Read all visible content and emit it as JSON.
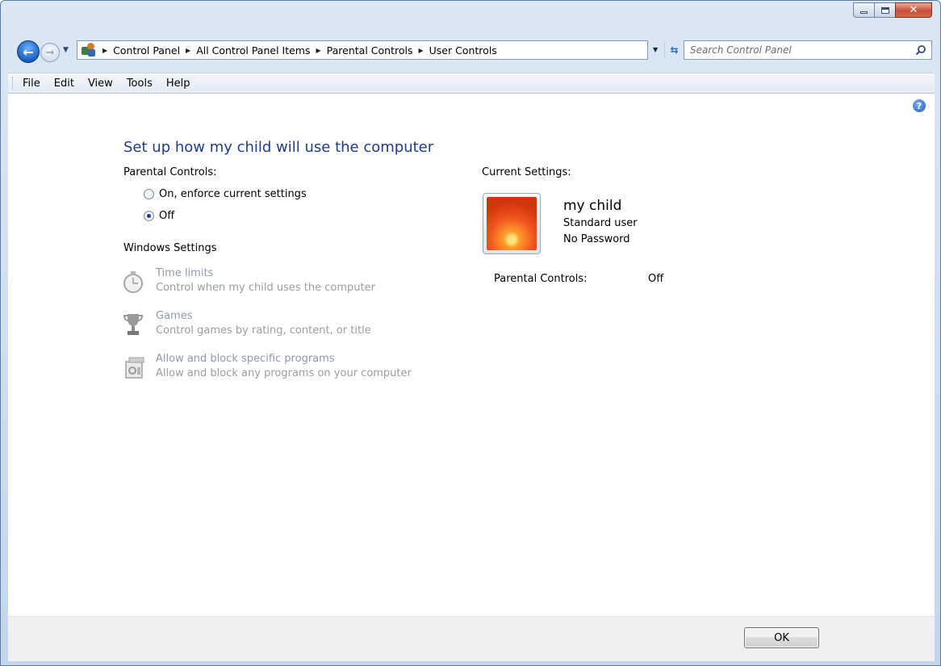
{
  "window": {
    "controls": {
      "minimize": "minimize",
      "maximize": "maximize",
      "close": "close"
    }
  },
  "address_bar": {
    "breadcrumbs": [
      "Control Panel",
      "All Control Panel Items",
      "Parental Controls",
      "User Controls"
    ],
    "search_placeholder": "Search Control Panel"
  },
  "menu": [
    "File",
    "Edit",
    "View",
    "Tools",
    "Help"
  ],
  "page": {
    "heading": "Set up how my child will use the computer",
    "parental_controls_label": "Parental Controls:",
    "options": [
      {
        "label": "On, enforce current settings",
        "checked": false
      },
      {
        "label": "Off",
        "checked": true
      }
    ],
    "windows_settings_label": "Windows Settings",
    "settings": [
      {
        "title": "Time limits",
        "description": "Control when my child uses the computer",
        "icon": "stopwatch-icon"
      },
      {
        "title": "Games",
        "description": "Control games by rating, content, or title",
        "icon": "trophy-icon"
      },
      {
        "title": "Allow and block specific programs",
        "description": "Allow and block any programs on your computer",
        "icon": "programs-icon"
      }
    ]
  },
  "current_settings": {
    "label": "Current Settings:",
    "user_name": "my child",
    "account_type": "Standard user",
    "password_status": "No Password",
    "parental_controls_label": "Parental Controls:",
    "parental_controls_value": "Off"
  },
  "footer": {
    "ok_label": "OK"
  },
  "colors": {
    "heading": "#1e3d8b",
    "disabled_text": "#9d9d9d",
    "close_button": "#c74f35"
  }
}
